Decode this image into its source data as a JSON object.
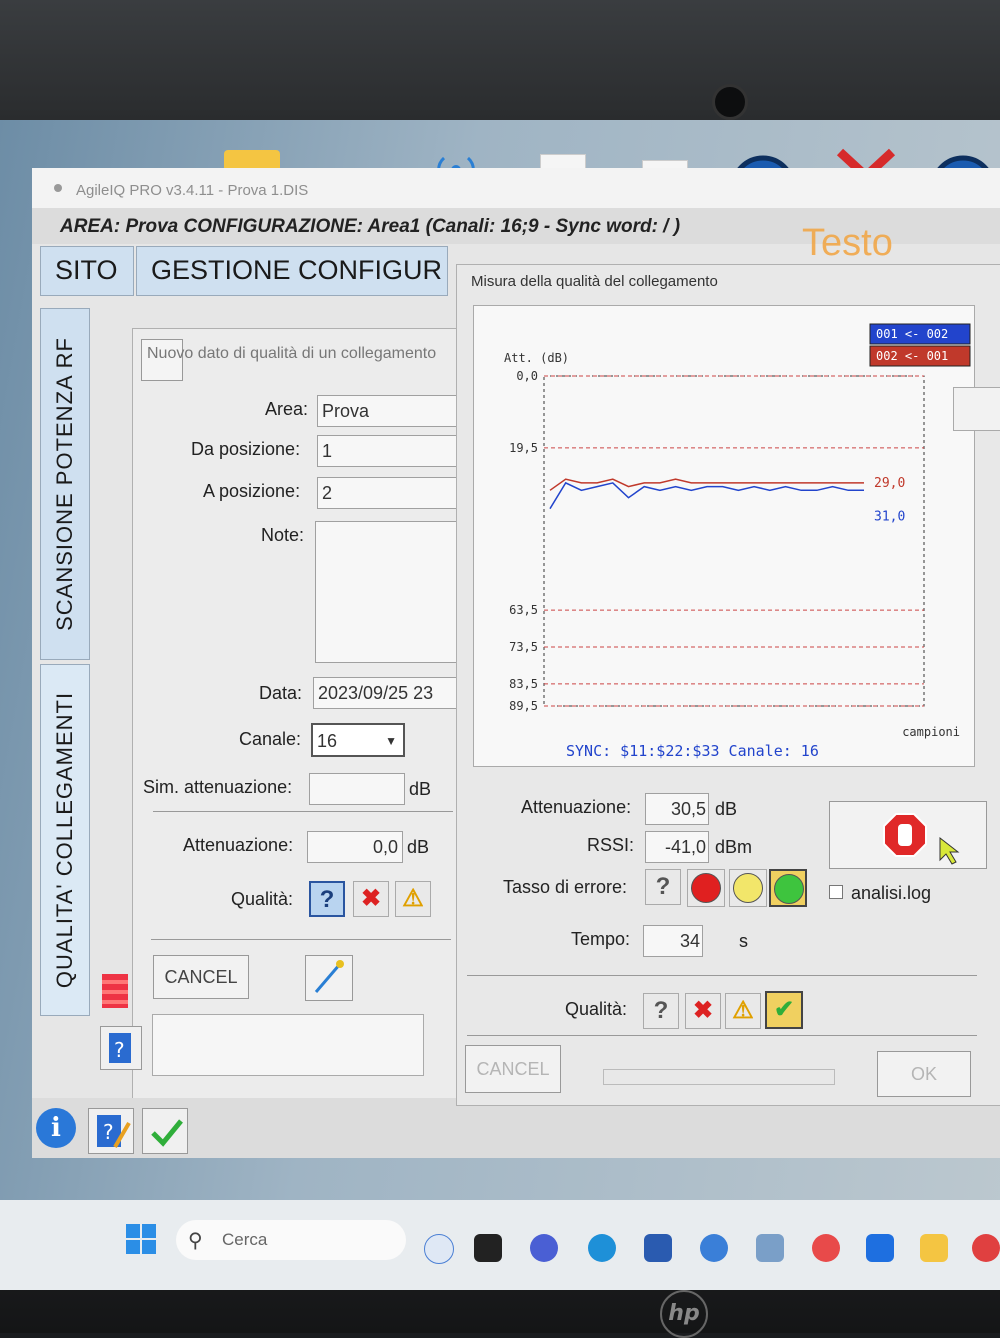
{
  "window": {
    "title": "AgileIQ PRO v3.4.11 - Prova 1.DIS",
    "status_line": "AREA: Prova   CONFIGURAZIONE: Area1 (Canali: 16;9 - Sync word: / )",
    "watermark": "Testo"
  },
  "menu": {
    "sito": "SITO",
    "gestione": "GESTIONE CONFIGUR"
  },
  "vertical_tabs": {
    "scansione": "SCANSIONE POTENZA RF",
    "qualita": "QUALITA' COLLEGAMENTI"
  },
  "left_dialog": {
    "header": "Nuovo dato di qualità di un collegamento",
    "area_label": "Area:",
    "area_value": "Prova",
    "da_label": "Da posizione:",
    "da_value": "1",
    "a_label": "A posizione:",
    "a_value": "2",
    "note_label": "Note:",
    "data_label": "Data:",
    "data_value": "2023/09/25 23",
    "canale_label": "Canale:",
    "canale_value": "16",
    "sim_label": "Sim. attenuazione:",
    "sim_unit": "dB",
    "att_label": "Attenuazione:",
    "att_value": "0,0",
    "att_unit": "dB",
    "qualita_label": "Qualità:",
    "cancel": "CANCEL"
  },
  "right_dialog": {
    "title": "Misura della qualità del collegamento",
    "att_label": "Attenuazione:",
    "att_value": "30,5",
    "att_unit": "dB",
    "rssi_label": "RSSI:",
    "rssi_value": "-41,0",
    "rssi_unit": "dBm",
    "tasso_label": "Tasso di errore:",
    "analisi": "analisi.log",
    "tempo_label": "Tempo:",
    "tempo_value": "34",
    "tempo_unit": "s",
    "qualita_label": "Qualità:",
    "cancel": "CANCEL",
    "ok": "OK"
  },
  "chart_data": {
    "type": "line",
    "ylabel": "Att. (dB)",
    "xlabel": "campioni",
    "yticks": [
      "0,0",
      "19,5",
      "63,5",
      "73,5",
      "83,5",
      "89,5"
    ],
    "ytick_values": [
      0,
      19.5,
      63.5,
      73.5,
      83.5,
      89.5
    ],
    "ylim": [
      0,
      89.5
    ],
    "legend": [
      "001 <- 002",
      "002 <- 001"
    ],
    "series": [
      {
        "name": "001 <- 002",
        "color": "#2244cc",
        "label": "31,0",
        "values": [
          36,
          29,
          31,
          30,
          29,
          33,
          30,
          31,
          30,
          31,
          30,
          30,
          31,
          30,
          31,
          30,
          31,
          31,
          30,
          31,
          31
        ]
      },
      {
        "name": "002 <- 001",
        "color": "#c0392b",
        "label": "29,0",
        "values": [
          31,
          28,
          29,
          29,
          28,
          30,
          29,
          29,
          28,
          29,
          29,
          29,
          29,
          29,
          29,
          29,
          29,
          29,
          29,
          29,
          29
        ]
      }
    ],
    "footer": "SYNC: $11:$22:$33 Canale: 16"
  },
  "taskbar": {
    "search": "Cerca"
  },
  "brand": "hp"
}
